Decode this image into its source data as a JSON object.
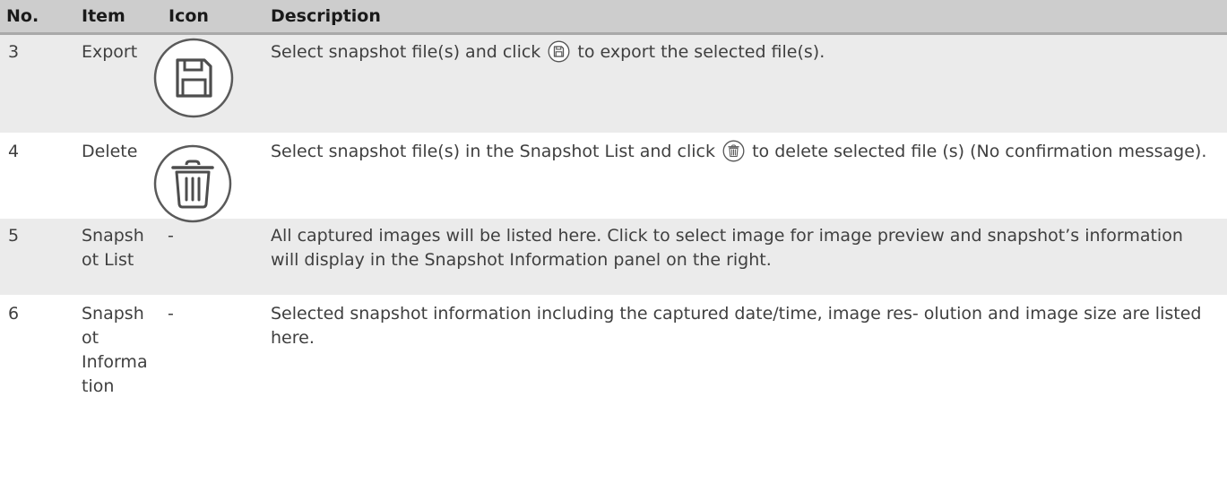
{
  "headers": {
    "no": "No.",
    "item": "Item",
    "icon": "Icon",
    "description": "Description"
  },
  "rows": [
    {
      "no": "3",
      "item": "Export",
      "icon": "save-icon",
      "description_before": "Select snapshot file(s) and click",
      "inline_icon": "save-icon",
      "description_after": "to export the selected file(s)."
    },
    {
      "no": "4",
      "item": "Delete",
      "icon": "trash-icon",
      "description_before": "Select snapshot file(s) in the Snapshot List and click",
      "inline_icon": "trash-icon",
      "description_after": "to delete selected file (s)  (No confirmation message)."
    },
    {
      "no": "5",
      "item": "Snapshot List",
      "icon_text": "-",
      "description": "All captured images will be listed here. Click to select image for image preview and snapshot’s information will display in the Snapshot Information panel on the right."
    },
    {
      "no": "6",
      "item": "Snapshot Information",
      "icon_text": "-",
      "description": "Selected snapshot information including the captured date/time, image res- olution and image size are listed here."
    }
  ],
  "colors": {
    "header_bg": "#cdcdcd",
    "header_border": "#a9a9a9",
    "row_shade": "#ebebeb",
    "text": "#3f3f3f",
    "icon_stroke": "#555555"
  }
}
